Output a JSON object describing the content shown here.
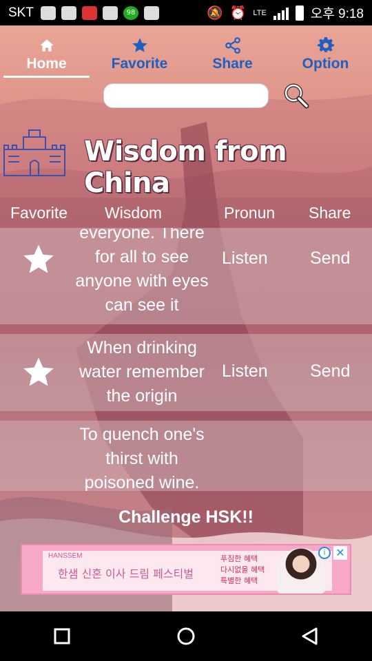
{
  "status_bar": {
    "carrier": "SKT",
    "network": "LTE",
    "time": "오후 9:18",
    "badge_count": "98"
  },
  "nav": {
    "tabs": [
      {
        "label": "Home",
        "icon": "home-icon",
        "active": true
      },
      {
        "label": "Favorite",
        "icon": "star-icon",
        "active": false
      },
      {
        "label": "Share",
        "icon": "share-icon",
        "active": false
      },
      {
        "label": "Option",
        "icon": "gear-icon",
        "active": false
      }
    ]
  },
  "search": {
    "value": "",
    "placeholder": ""
  },
  "title": "Wisdom from China",
  "table": {
    "headers": {
      "favorite": "Favorite",
      "wisdom": "Wisdom",
      "pronun": "Pronun",
      "share": "Share"
    },
    "rows": [
      {
        "wisdom_lines": [
          "everyone. There",
          "for all to see",
          "anyone with eyes",
          "can see it"
        ],
        "listen": "Listen",
        "send": "Send"
      },
      {
        "wisdom_lines": [
          "When drinking",
          "water remember",
          "the origin"
        ],
        "listen": "Listen",
        "send": "Send"
      },
      {
        "wisdom_lines": [
          "To quench one's",
          "thirst with",
          "poisoned wine."
        ],
        "listen": "",
        "send": ""
      }
    ]
  },
  "challenge": "Challenge HSK!!",
  "ad": {
    "brand": "HANSSEM",
    "headline": "한샘 신혼 이사 드림 페스티벌",
    "offer_lines": [
      "푸짐한 혜택",
      "다시없을 혜택",
      "특별한 혜택"
    ],
    "close": "✕",
    "adchoices": "i"
  }
}
